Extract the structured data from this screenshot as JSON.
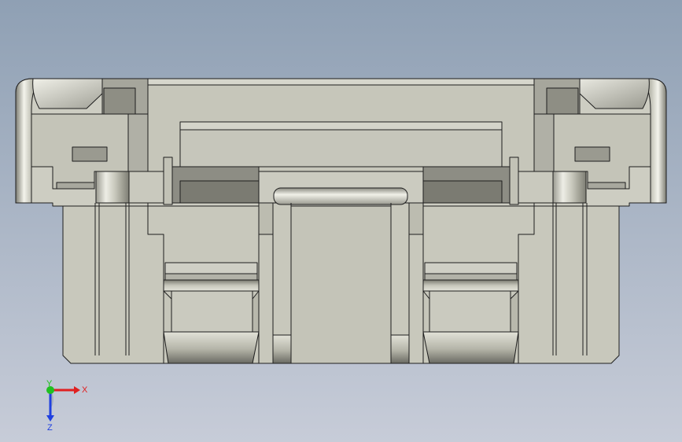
{
  "viewport": {
    "background_top": "#8fa0b4",
    "background_bottom": "#c7ccd8"
  },
  "model": {
    "base_color": "#c8c8bc",
    "light_face": "#dcdcd2",
    "mid_face": "#bebeb2",
    "dark_face": "#8a8a80",
    "edge_color": "#202020"
  },
  "triad": {
    "x_label": "X",
    "y_label": "Y",
    "z_label": "Z",
    "x_color": "#e02020",
    "y_color": "#20c020",
    "z_color": "#2040e0",
    "x_icon": "arrow-right-icon",
    "z_icon": "arrow-down-icon"
  }
}
